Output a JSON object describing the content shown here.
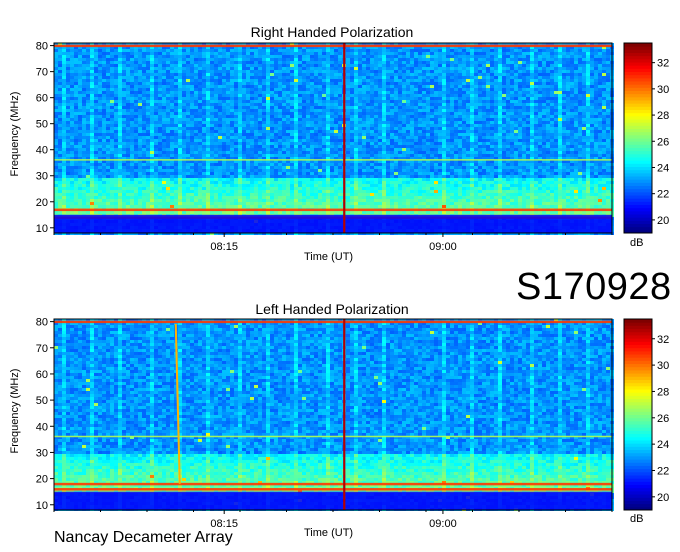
{
  "chart_data": [
    {
      "type": "heatmap",
      "title": "Right Handed Polarization",
      "xlabel": "Time (UT)",
      "ylabel": "Frequency (MHz)",
      "x_ticks": [
        "08:15",
        "09:00"
      ],
      "y_ticks": [
        10,
        20,
        30,
        40,
        50,
        60,
        70,
        80
      ],
      "ylim": [
        8,
        81
      ],
      "colorbar": {
        "label": "dB",
        "ticks": [
          20,
          22,
          24,
          26,
          28,
          30,
          32
        ],
        "range": [
          19,
          33.5
        ]
      },
      "features": {
        "vertical_burst_fraction": 0.52,
        "enhanced_band_mhz": [
          15,
          30
        ],
        "bright_lines_mhz": [
          80,
          36,
          17,
          14
        ]
      }
    },
    {
      "type": "heatmap",
      "title": "Left Handed Polarization",
      "xlabel": "Time (UT)",
      "ylabel": "Frequency (MHz)",
      "x_ticks": [
        "08:15",
        "09:00"
      ],
      "y_ticks": [
        10,
        20,
        30,
        40,
        50,
        60,
        70,
        80
      ],
      "ylim": [
        8,
        81
      ],
      "colorbar": {
        "label": "dB",
        "ticks": [
          20,
          22,
          24,
          26,
          28,
          30,
          32
        ],
        "range": [
          19,
          33.5
        ]
      },
      "features": {
        "vertical_burst_fraction": 0.52,
        "drifting_burst_fraction": 0.22,
        "enhanced_band_mhz": [
          15,
          30
        ],
        "bright_lines_mhz": [
          80,
          36,
          18,
          16
        ]
      }
    }
  ],
  "stamp": "S170928",
  "footer": "Nancay Decameter Array"
}
